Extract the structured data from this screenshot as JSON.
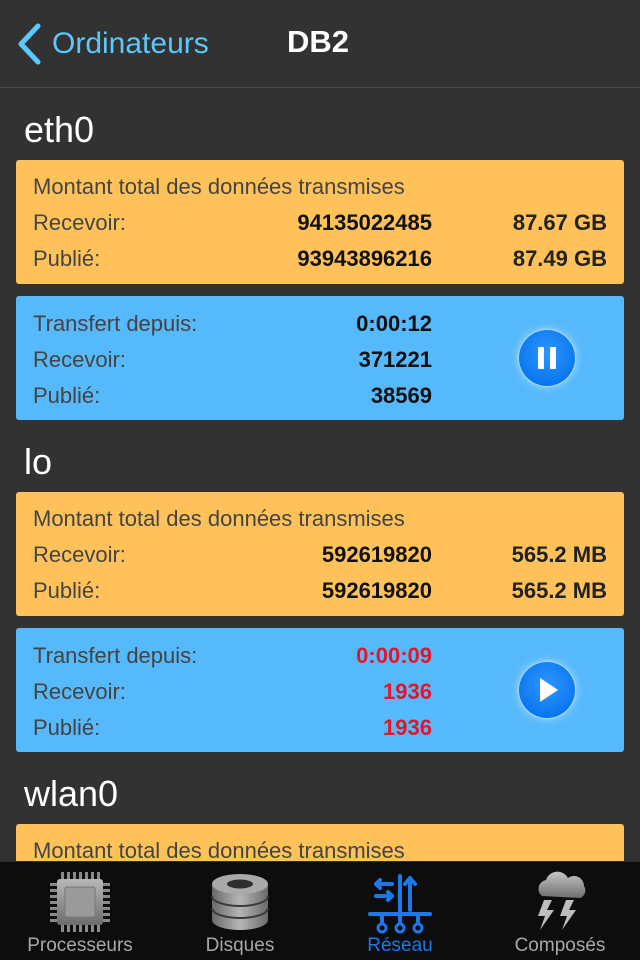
{
  "nav": {
    "back_label": "Ordinateurs",
    "title": "DB2"
  },
  "interfaces": [
    {
      "name": "eth0",
      "totals": {
        "title": "Montant total des données transmises",
        "receive_label": "Recevoir:",
        "receive_bytes": "94135022485",
        "receive_size": "87.67 GB",
        "sent_label": "Publié:",
        "sent_bytes": "93943896216",
        "sent_size": "87.49 GB"
      },
      "transfer": {
        "since_label": "Transfert depuis:",
        "since_value": "0:00:12",
        "receive_label": "Recevoir:",
        "receive_value": "371221",
        "sent_label": "Publié:",
        "sent_value": "38569",
        "state": "pause-icon",
        "value_color": "#111111"
      }
    },
    {
      "name": "lo",
      "totals": {
        "title": "Montant total des données transmises",
        "receive_label": "Recevoir:",
        "receive_bytes": "592619820",
        "receive_size": "565.2 MB",
        "sent_label": "Publié:",
        "sent_bytes": "592619820",
        "sent_size": "565.2 MB"
      },
      "transfer": {
        "since_label": "Transfert depuis:",
        "since_value": "0:00:09",
        "receive_label": "Recevoir:",
        "receive_value": "1936",
        "sent_label": "Publié:",
        "sent_value": "1936",
        "state": "play-icon",
        "value_color": "#e8132a"
      }
    },
    {
      "name": "wlan0",
      "totals": {
        "title": "Montant total des données transmises"
      }
    }
  ],
  "tabs": [
    {
      "label": "Processeurs",
      "icon": "cpu-chip-icon",
      "active": false
    },
    {
      "label": "Disques",
      "icon": "disk-stack-icon",
      "active": false
    },
    {
      "label": "Réseau",
      "icon": "network-switch-icon",
      "active": true
    },
    {
      "label": "Composés",
      "icon": "storm-cloud-icon",
      "active": false
    }
  ],
  "colors": {
    "background": "#323232",
    "totals_card": "#ffc25a",
    "transfer_card": "#56b9fb",
    "accent": "#5ac8fa",
    "active_tab": "#1d78e8",
    "alert_red": "#e8132a"
  }
}
